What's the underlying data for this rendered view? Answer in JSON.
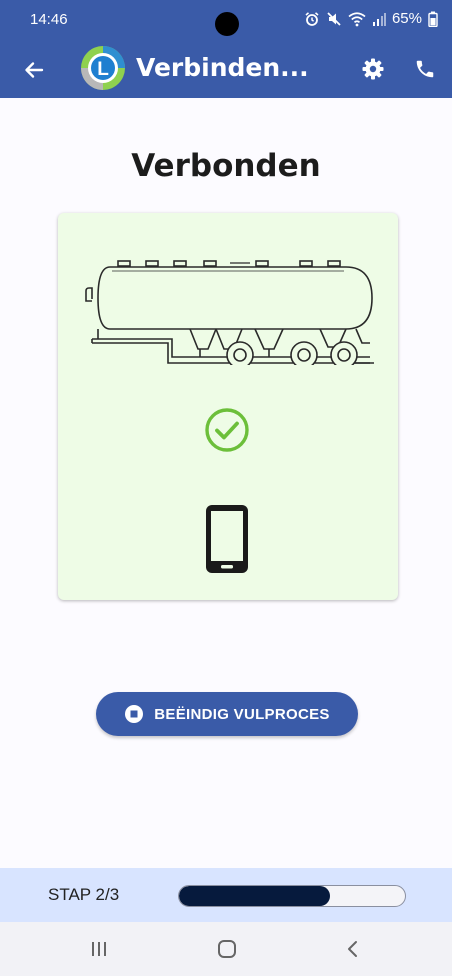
{
  "status_bar": {
    "time": "14:46",
    "battery": "65%",
    "icons": [
      "alarm-icon",
      "mute-icon",
      "wifi-icon",
      "signal-icon",
      "battery-icon"
    ]
  },
  "app_bar": {
    "title": "Verbinden...",
    "back_icon": "arrow-back-icon",
    "logo_letter": "L",
    "settings_icon": "gear-icon",
    "phone_icon": "phone-icon",
    "color": "#3a5ba8"
  },
  "main": {
    "heading": "Verbonden",
    "card_background": "#eefce6",
    "illustrations": [
      "tanker-trailer-illustration",
      "check-circle-icon",
      "smartphone-icon"
    ],
    "check_color": "#6cbf3a"
  },
  "actions": {
    "end_button_label": "BEËINDIG VULPROCES",
    "end_button_icon": "stop-circle-icon"
  },
  "progress": {
    "step_label": "STAP 2/3",
    "value": 0.67
  },
  "nav_bar": {
    "icons": [
      "recents-icon",
      "home-icon",
      "back-icon"
    ]
  }
}
